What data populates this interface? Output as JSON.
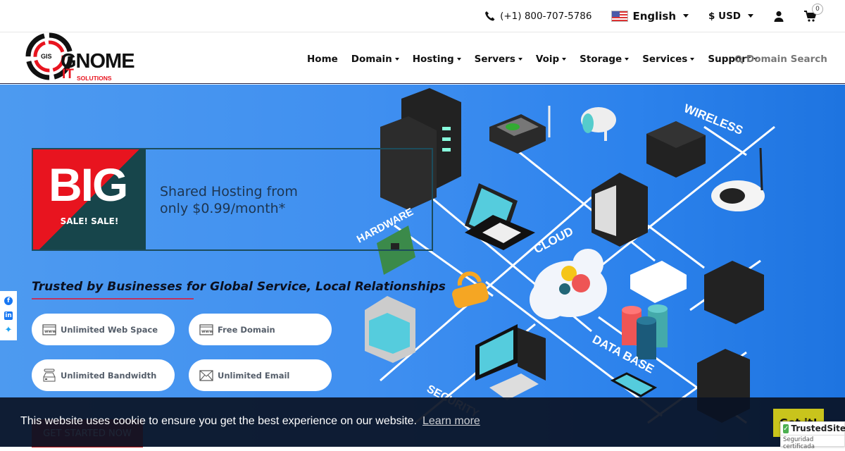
{
  "topbar": {
    "phone": "(+1) 800-707-5786",
    "language": "English",
    "currency": "$ USD",
    "cart_count": "0"
  },
  "logo": {
    "small": "GIS",
    "main": "GNOME",
    "it": "IT",
    "sub": "SOLUTIONS"
  },
  "nav": {
    "items": [
      {
        "label": "Home",
        "dropdown": false
      },
      {
        "label": "Domain",
        "dropdown": true
      },
      {
        "label": "Hosting",
        "dropdown": true
      },
      {
        "label": "Servers",
        "dropdown": true
      },
      {
        "label": "Voip",
        "dropdown": true
      },
      {
        "label": "Storage",
        "dropdown": true
      },
      {
        "label": "Services",
        "dropdown": true
      },
      {
        "label": "Support",
        "dropdown": true
      }
    ],
    "domain_search": "Domain Search"
  },
  "hero": {
    "promo_big": "BIG",
    "promo_sale": "SALE! SALE!",
    "promo_line1": "Shared Hosting from",
    "promo_line2": "only $0.99/month*",
    "tagline": "Trusted by Businesses for Global Service, Local Relationships",
    "features": [
      {
        "label": "Unlimited Web Space",
        "icon": "www-icon"
      },
      {
        "label": "Free Domain",
        "icon": "www-icon"
      },
      {
        "label": "Unlimited Bandwidth",
        "icon": "bandwidth-icon"
      },
      {
        "label": "Unlimited Email",
        "icon": "envelope-icon"
      }
    ],
    "cta": "GET STARTED NOW",
    "illustration_labels": [
      "HARDWARE",
      "CLOUD",
      "WIRELESS",
      "DATA BASE",
      "SECURITY"
    ]
  },
  "cookie": {
    "text": "This website uses cookie to ensure you get the best experience on our website.",
    "link": "Learn more",
    "button": "Got it!"
  },
  "trusted": {
    "title": "TrustedSite",
    "subtitle": "Seguridad certificada"
  },
  "colors": {
    "accent_red": "#e8141f",
    "dark_teal": "#17454b",
    "hero_blue": "#3f8ff0",
    "cookie_button": "#c9c41c"
  }
}
